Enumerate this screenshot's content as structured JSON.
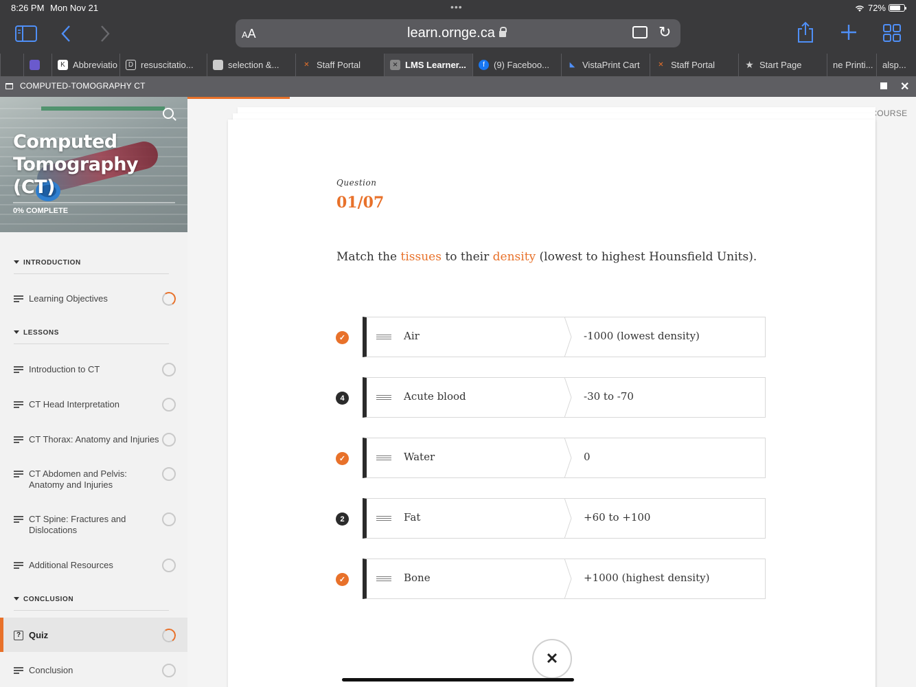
{
  "status": {
    "time": "8:26 PM",
    "date": "Mon Nov 21",
    "battery": "72%"
  },
  "browser": {
    "url": "learn.ornge.ca",
    "aa_label": "AA",
    "tabs": [
      {
        "label": "",
        "icon": "tab-partial-icon"
      },
      {
        "label": "",
        "icon": "shield-favicon"
      },
      {
        "label": "Abbreviatio",
        "icon": "k-favicon"
      },
      {
        "label": "resuscitatio...",
        "icon": "d-favicon"
      },
      {
        "label": "selection &...",
        "icon": "doc-favicon"
      },
      {
        "label": "Staff Portal",
        "icon": "portal-favicon"
      },
      {
        "label": "LMS Learner...",
        "icon": "close-tab-icon"
      },
      {
        "label": "(9) Faceboo...",
        "icon": "facebook-favicon"
      },
      {
        "label": "VistaPrint Cart",
        "icon": "vistaprint-favicon"
      },
      {
        "label": "Staff Portal",
        "icon": "portal-favicon"
      },
      {
        "label": "Start Page",
        "icon": "star-icon"
      },
      {
        "label": "ne Printi...",
        "icon": ""
      },
      {
        "label": "alsp...",
        "icon": ""
      }
    ]
  },
  "course_bar": {
    "title": "COMPUTED-TOMOGRAPHY CT"
  },
  "sidebar": {
    "course_title": "Computed Tomography (CT)",
    "progress": 0,
    "progress_label": "0% COMPLETE",
    "sections": [
      {
        "title": "INTRODUCTION"
      },
      {
        "title": "LESSONS"
      },
      {
        "title": "CONCLUSION"
      }
    ],
    "items": [
      {
        "label": "Learning Objectives",
        "status": "in-progress"
      },
      {
        "label": "Introduction to CT",
        "status": "not-started"
      },
      {
        "label": "CT Head Interpretation",
        "status": "not-started"
      },
      {
        "label": "CT Thorax: Anatomy and Injuries",
        "status": "not-started"
      },
      {
        "label": "CT Abdomen and Pelvis: Anatomy and Injuries",
        "status": "not-started"
      },
      {
        "label": "CT Spine: Fractures and Dislocations",
        "status": "not-started"
      },
      {
        "label": "Additional Resources",
        "status": "not-started"
      },
      {
        "label": "Quiz",
        "status": "in-progress",
        "active": true
      },
      {
        "label": "Conclusion",
        "status": "not-started"
      }
    ]
  },
  "main": {
    "exit_label": "EXIT COURSE",
    "question_label": "Question",
    "question_number": "01/07",
    "question_text": {
      "part1": "Match the ",
      "hl1": "tissues",
      "part2": " to their ",
      "hl2": "density",
      "part3": " (lowest to highest Hounsfield Units)."
    },
    "pairs": [
      {
        "left": "Air",
        "right": "-1000 (lowest density)",
        "marker": "check"
      },
      {
        "left": "Acute blood",
        "right": "-30 to -70",
        "marker": "4"
      },
      {
        "left": "Water",
        "right": "0",
        "marker": "check"
      },
      {
        "left": "Fat",
        "right": "+60 to +100",
        "marker": "2"
      },
      {
        "left": "Bone",
        "right": "+1000 (highest density)",
        "marker": "check"
      }
    ],
    "close_label": "✕"
  },
  "colors": {
    "accent": "#e8712a",
    "dark": "#2b2b2b",
    "browser_blue": "#4f8ff7"
  }
}
